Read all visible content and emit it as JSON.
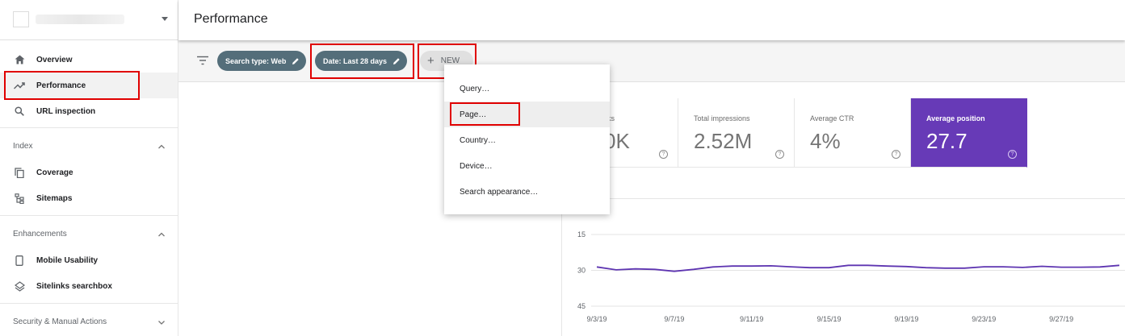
{
  "header": {
    "title": "Performance"
  },
  "sidebar": {
    "items": [
      {
        "label": "Overview",
        "icon": "home-icon"
      },
      {
        "label": "Performance",
        "icon": "trending-up-icon",
        "active": true
      },
      {
        "label": "URL inspection",
        "icon": "search-icon"
      }
    ],
    "sections": [
      {
        "label": "Index",
        "expanded": true,
        "items": [
          {
            "label": "Coverage",
            "icon": "copy-icon"
          },
          {
            "label": "Sitemaps",
            "icon": "sitemap-icon"
          }
        ]
      },
      {
        "label": "Enhancements",
        "expanded": true,
        "items": [
          {
            "label": "Mobile Usability",
            "icon": "phone-icon"
          },
          {
            "label": "Sitelinks searchbox",
            "icon": "layers-icon"
          }
        ]
      },
      {
        "label": "Security & Manual Actions",
        "expanded": false,
        "items": []
      }
    ]
  },
  "filters": {
    "chips": [
      {
        "label": "Search type: Web"
      },
      {
        "label": "Date: Last 28 days"
      }
    ],
    "new_label": "NEW"
  },
  "menu": {
    "items": [
      "Query…",
      "Page…",
      "Country…",
      "Device…",
      "Search appearance…"
    ],
    "hovered_index": 1
  },
  "metrics": [
    {
      "label": "ks",
      "value": "0K"
    },
    {
      "label": "Total impressions",
      "value": "2.52M"
    },
    {
      "label": "Average CTR",
      "value": "4%"
    },
    {
      "label": "Average position",
      "value": "27.7",
      "selected": true
    }
  ],
  "colors": {
    "accent_purple": "#673ab7",
    "chip": "#546e7a",
    "highlight": "#e00000",
    "line": "#5e35b1"
  },
  "chart_data": {
    "type": "line",
    "x": [
      "9/3/19",
      "9/4/19",
      "9/5/19",
      "9/6/19",
      "9/7/19",
      "9/8/19",
      "9/9/19",
      "9/10/19",
      "9/11/19",
      "9/12/19",
      "9/13/19",
      "9/14/19",
      "9/15/19",
      "9/16/19",
      "9/17/19",
      "9/18/19",
      "9/19/19",
      "9/20/19",
      "9/21/19",
      "9/22/19",
      "9/23/19",
      "9/24/19",
      "9/25/19",
      "9/26/19",
      "9/27/19",
      "9/28/19",
      "9/29/19",
      "9/30/19"
    ],
    "tick_labels": [
      "9/3/19",
      "9/7/19",
      "9/11/19",
      "9/15/19",
      "9/19/19",
      "9/23/19",
      "9/27/19"
    ],
    "series": [
      {
        "values": [
          28.6,
          29.8,
          29.4,
          29.6,
          30.4,
          29.6,
          28.6,
          28.2,
          28.2,
          28.1,
          28.5,
          28.9,
          28.9,
          27.9,
          27.9,
          28.2,
          28.4,
          28.9,
          29.1,
          29.1,
          28.5,
          28.5,
          28.8,
          28.3,
          28.7,
          28.7,
          28.6,
          27.9
        ]
      }
    ],
    "yticks": [
      15,
      30,
      45
    ],
    "ylim": [
      45,
      15
    ],
    "y_inverted": true,
    "grid": true
  }
}
